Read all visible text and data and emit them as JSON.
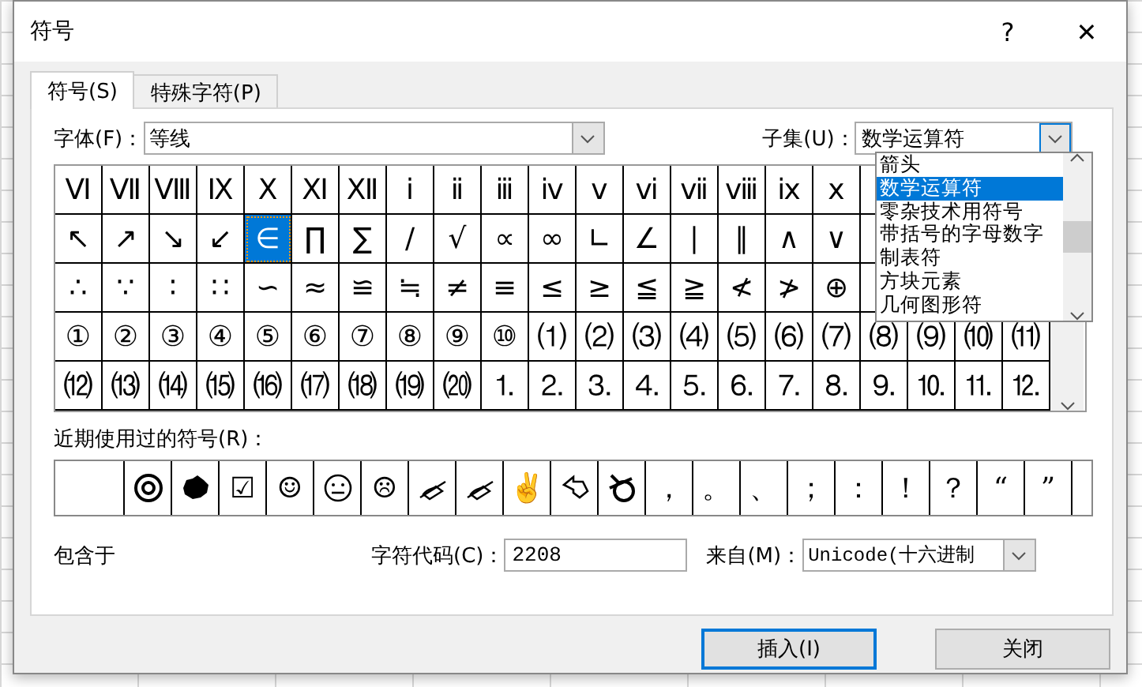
{
  "window": {
    "title": "符号",
    "help": "?",
    "close": "✕"
  },
  "tabs": [
    {
      "label": "符号(S)",
      "selected": true
    },
    {
      "label": "特殊字符(P)",
      "selected": false
    }
  ],
  "font": {
    "label": "字体(F)：",
    "value": "等线"
  },
  "subset": {
    "label": "子集(U)：",
    "value": "数学运算符",
    "expanded": true,
    "options": [
      {
        "label": "箭头",
        "selected": false
      },
      {
        "label": "数学运算符",
        "selected": true
      },
      {
        "label": "零杂技术用符号",
        "selected": false
      },
      {
        "label": "带括号的字母数字",
        "selected": false
      },
      {
        "label": "制表符",
        "selected": false
      },
      {
        "label": "方块元素",
        "selected": false
      },
      {
        "label": "几何图形符",
        "selected": false
      }
    ]
  },
  "symbols": [
    [
      {
        "char": "Ⅵ",
        "selected": false
      },
      {
        "char": "Ⅶ",
        "selected": false
      },
      {
        "char": "Ⅷ",
        "selected": false
      },
      {
        "char": "Ⅸ",
        "selected": false
      },
      {
        "char": "Ⅹ",
        "selected": false
      },
      {
        "char": "Ⅺ",
        "selected": false
      },
      {
        "char": "Ⅻ",
        "selected": false
      },
      {
        "char": "ⅰ",
        "selected": false
      },
      {
        "char": "ⅱ",
        "selected": false
      },
      {
        "char": "ⅲ",
        "selected": false
      },
      {
        "char": "ⅳ",
        "selected": false
      },
      {
        "char": "ⅴ",
        "selected": false
      },
      {
        "char": "ⅵ",
        "selected": false
      },
      {
        "char": "ⅶ",
        "selected": false
      },
      {
        "char": "ⅷ",
        "selected": false
      },
      {
        "char": "ⅸ",
        "selected": false
      },
      {
        "char": "ⅹ",
        "selected": false
      }
    ],
    [
      {
        "char": "↖",
        "selected": false
      },
      {
        "char": "↗",
        "selected": false
      },
      {
        "char": "↘",
        "selected": false
      },
      {
        "char": "↙",
        "selected": false
      },
      {
        "char": "∈",
        "selected": true
      },
      {
        "char": "∏",
        "selected": false
      },
      {
        "char": "∑",
        "selected": false
      },
      {
        "char": "∕",
        "selected": false
      },
      {
        "char": "√",
        "selected": false
      },
      {
        "char": "∝",
        "selected": false
      },
      {
        "char": "∞",
        "selected": false
      },
      {
        "char": "∟",
        "selected": false
      },
      {
        "char": "∠",
        "selected": false
      },
      {
        "char": "∣",
        "selected": false
      },
      {
        "char": "∥",
        "selected": false
      },
      {
        "char": "∧",
        "selected": false
      },
      {
        "char": "∨",
        "selected": false
      }
    ],
    [
      {
        "char": "∴",
        "selected": false
      },
      {
        "char": "∵",
        "selected": false
      },
      {
        "char": "∶",
        "selected": false
      },
      {
        "char": "∷",
        "selected": false
      },
      {
        "char": "∽",
        "selected": false
      },
      {
        "char": "≈",
        "selected": false
      },
      {
        "char": "≌",
        "selected": false
      },
      {
        "char": "≒",
        "selected": false
      },
      {
        "char": "≠",
        "selected": false
      },
      {
        "char": "≡",
        "selected": false
      },
      {
        "char": "≤",
        "selected": false
      },
      {
        "char": "≥",
        "selected": false
      },
      {
        "char": "≦",
        "selected": false
      },
      {
        "char": "≧",
        "selected": false
      },
      {
        "char": "≮",
        "selected": false
      },
      {
        "char": "≯",
        "selected": false
      },
      {
        "char": "⊕",
        "selected": false
      }
    ],
    [
      {
        "char": "①",
        "selected": false
      },
      {
        "char": "②",
        "selected": false
      },
      {
        "char": "③",
        "selected": false
      },
      {
        "char": "④",
        "selected": false
      },
      {
        "char": "⑤",
        "selected": false
      },
      {
        "char": "⑥",
        "selected": false
      },
      {
        "char": "⑦",
        "selected": false
      },
      {
        "char": "⑧",
        "selected": false
      },
      {
        "char": "⑨",
        "selected": false
      },
      {
        "char": "⑩",
        "selected": false
      },
      {
        "char": "⑴",
        "selected": false
      },
      {
        "char": "⑵",
        "selected": false
      },
      {
        "char": "⑶",
        "selected": false
      },
      {
        "char": "⑷",
        "selected": false
      },
      {
        "char": "⑸",
        "selected": false
      },
      {
        "char": "⑹",
        "selected": false
      },
      {
        "char": "⑺",
        "selected": false
      },
      {
        "char": "⑻",
        "selected": false
      },
      {
        "char": "⑼",
        "selected": false
      },
      {
        "char": "⑽",
        "selected": false
      },
      {
        "char": "⑾",
        "selected": false
      }
    ],
    [
      {
        "char": "⑿",
        "selected": false
      },
      {
        "char": "⒀",
        "selected": false
      },
      {
        "char": "⒁",
        "selected": false
      },
      {
        "char": "⒂",
        "selected": false
      },
      {
        "char": "⒃",
        "selected": false
      },
      {
        "char": "⒄",
        "selected": false
      },
      {
        "char": "⒅",
        "selected": false
      },
      {
        "char": "⒆",
        "selected": false
      },
      {
        "char": "⒇",
        "selected": false
      },
      {
        "char": "⒈",
        "selected": false
      },
      {
        "char": "⒉",
        "selected": false
      },
      {
        "char": "⒊",
        "selected": false
      },
      {
        "char": "⒋",
        "selected": false
      },
      {
        "char": "⒌",
        "selected": false
      },
      {
        "char": "⒍",
        "selected": false
      },
      {
        "char": "⒎",
        "selected": false
      },
      {
        "char": "⒏",
        "selected": false
      },
      {
        "char": "⒐",
        "selected": false
      },
      {
        "char": "⒑",
        "selected": false
      },
      {
        "char": "⒒",
        "selected": false
      },
      {
        "char": "⒓",
        "selected": false
      }
    ]
  ],
  "recent": {
    "label": "近期使用过的符号(R)：",
    "items": [
      {
        "kind": "blank"
      },
      {
        "kind": "badge"
      },
      {
        "kind": "blot"
      },
      {
        "kind": "glyph",
        "char": "☑"
      },
      {
        "kind": "glyph",
        "char": "☺"
      },
      {
        "kind": "neutral"
      },
      {
        "kind": "glyph",
        "char": "☹"
      },
      {
        "kind": "pen"
      },
      {
        "kind": "pen"
      },
      {
        "kind": "glyph",
        "char": "✌"
      },
      {
        "kind": "pointer"
      },
      {
        "kind": "bomb"
      },
      {
        "kind": "glyph",
        "char": "，"
      },
      {
        "kind": "glyph",
        "char": "。"
      },
      {
        "kind": "glyph",
        "char": "、"
      },
      {
        "kind": "glyph",
        "char": "；"
      },
      {
        "kind": "glyph",
        "char": "："
      },
      {
        "kind": "glyph",
        "char": "！"
      },
      {
        "kind": "glyph",
        "char": "？"
      },
      {
        "kind": "glyph",
        "char": "“"
      },
      {
        "kind": "glyph",
        "char": "”"
      }
    ]
  },
  "symbol_name": "包含于",
  "char_code": {
    "label": "字符代码(C)：",
    "value": "2208"
  },
  "from": {
    "label": "来自(M)：",
    "value": "Unicode(十六进制"
  },
  "buttons": [
    {
      "label": "插入(I)",
      "default": true
    },
    {
      "label": "关闭",
      "default": false
    }
  ]
}
